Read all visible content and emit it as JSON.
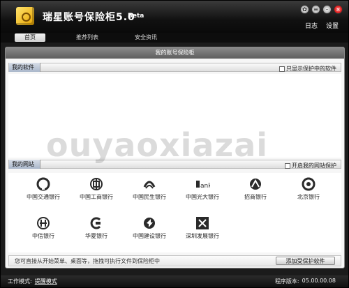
{
  "app": {
    "title": "瑞星账号保险柜5.0",
    "beta": "Beta",
    "menu_log": "日志",
    "menu_settings": "设置"
  },
  "nav": {
    "tabs": [
      {
        "label": "首页",
        "active": true
      },
      {
        "label": "推荐列表",
        "active": false
      },
      {
        "label": "安全资讯",
        "active": false
      }
    ]
  },
  "panel": {
    "title": "我的账号保险柜",
    "software_section": "我的软件",
    "software_checkbox": "只显示保护中的软件",
    "websites_section": "我的网站",
    "websites_checkbox": "开启我的网站保护",
    "banks": [
      {
        "name": "中国交通银行",
        "icon": "bocom-logo-icon"
      },
      {
        "name": "中国工商银行",
        "icon": "icbc-logo-icon"
      },
      {
        "name": "中国民生银行",
        "icon": "cmbc-logo-icon"
      },
      {
        "name": "中国光大银行",
        "icon": "ceb-logo-icon",
        "logo_text": "ank"
      },
      {
        "name": "招商银行",
        "icon": "cmb-logo-icon"
      },
      {
        "name": "北京银行",
        "icon": "bob-logo-icon"
      },
      {
        "name": "中信银行",
        "icon": "citic-logo-icon"
      },
      {
        "name": "华夏银行",
        "icon": "hxb-logo-icon"
      },
      {
        "name": "中国建设银行",
        "icon": "ccb-logo-icon"
      },
      {
        "name": "深圳发展银行",
        "icon": "sdb-logo-icon"
      }
    ],
    "hint": "您可直接从开始菜单、桌面等，拖拽可执行文件到保险柜中",
    "add_button": "添加受保护软件"
  },
  "status": {
    "mode_label": "工作模式:",
    "mode_value": "提醒模式",
    "version_label": "程序版本:",
    "version_value": "05.00.00.08"
  },
  "watermark": "ouyaoxiazai",
  "colors": {
    "titlebar": "#111111",
    "panel_header": "#6e6e6e",
    "section_title": "#b8c3d4",
    "bank_icon": "#2a2a2a"
  }
}
